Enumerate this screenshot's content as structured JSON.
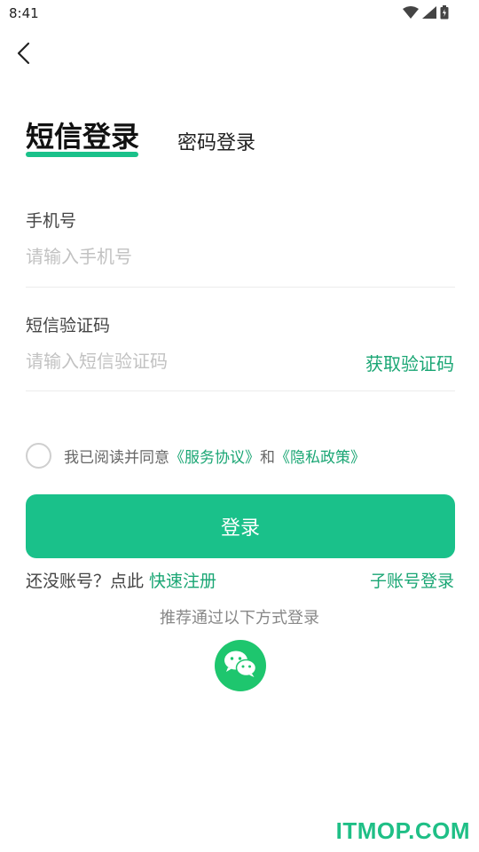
{
  "status_bar": {
    "time": "8:41",
    "icons": [
      "wifi-icon",
      "signal-icon",
      "battery-icon"
    ]
  },
  "nav": {
    "back_icon": "chevron-left-icon"
  },
  "tabs": [
    {
      "label": "短信登录",
      "active": true
    },
    {
      "label": "密码登录",
      "active": false
    }
  ],
  "form": {
    "phone_label": "手机号",
    "phone_placeholder": "请输入手机号",
    "phone_value": "",
    "code_label": "短信验证码",
    "code_placeholder": "请输入短信验证码",
    "code_value": "",
    "get_code_label": "获取验证码"
  },
  "agreement": {
    "checked": false,
    "prefix": "我已阅读并同意",
    "service_link": "《服务协议》",
    "conjunction": "和",
    "privacy_link": "《隐私政策》"
  },
  "login_button": "登录",
  "register": {
    "prompt": "还没账号？点此",
    "link": "快速注册"
  },
  "sub_account_link": "子账号登录",
  "other_methods_label": "推荐通过以下方式登录",
  "social": {
    "wechat_icon": "wechat-icon"
  },
  "watermark": "ITMOP.COM",
  "colors": {
    "accent": "#1ac18a",
    "link": "#1aa674",
    "wechat": "#1ec66e"
  }
}
